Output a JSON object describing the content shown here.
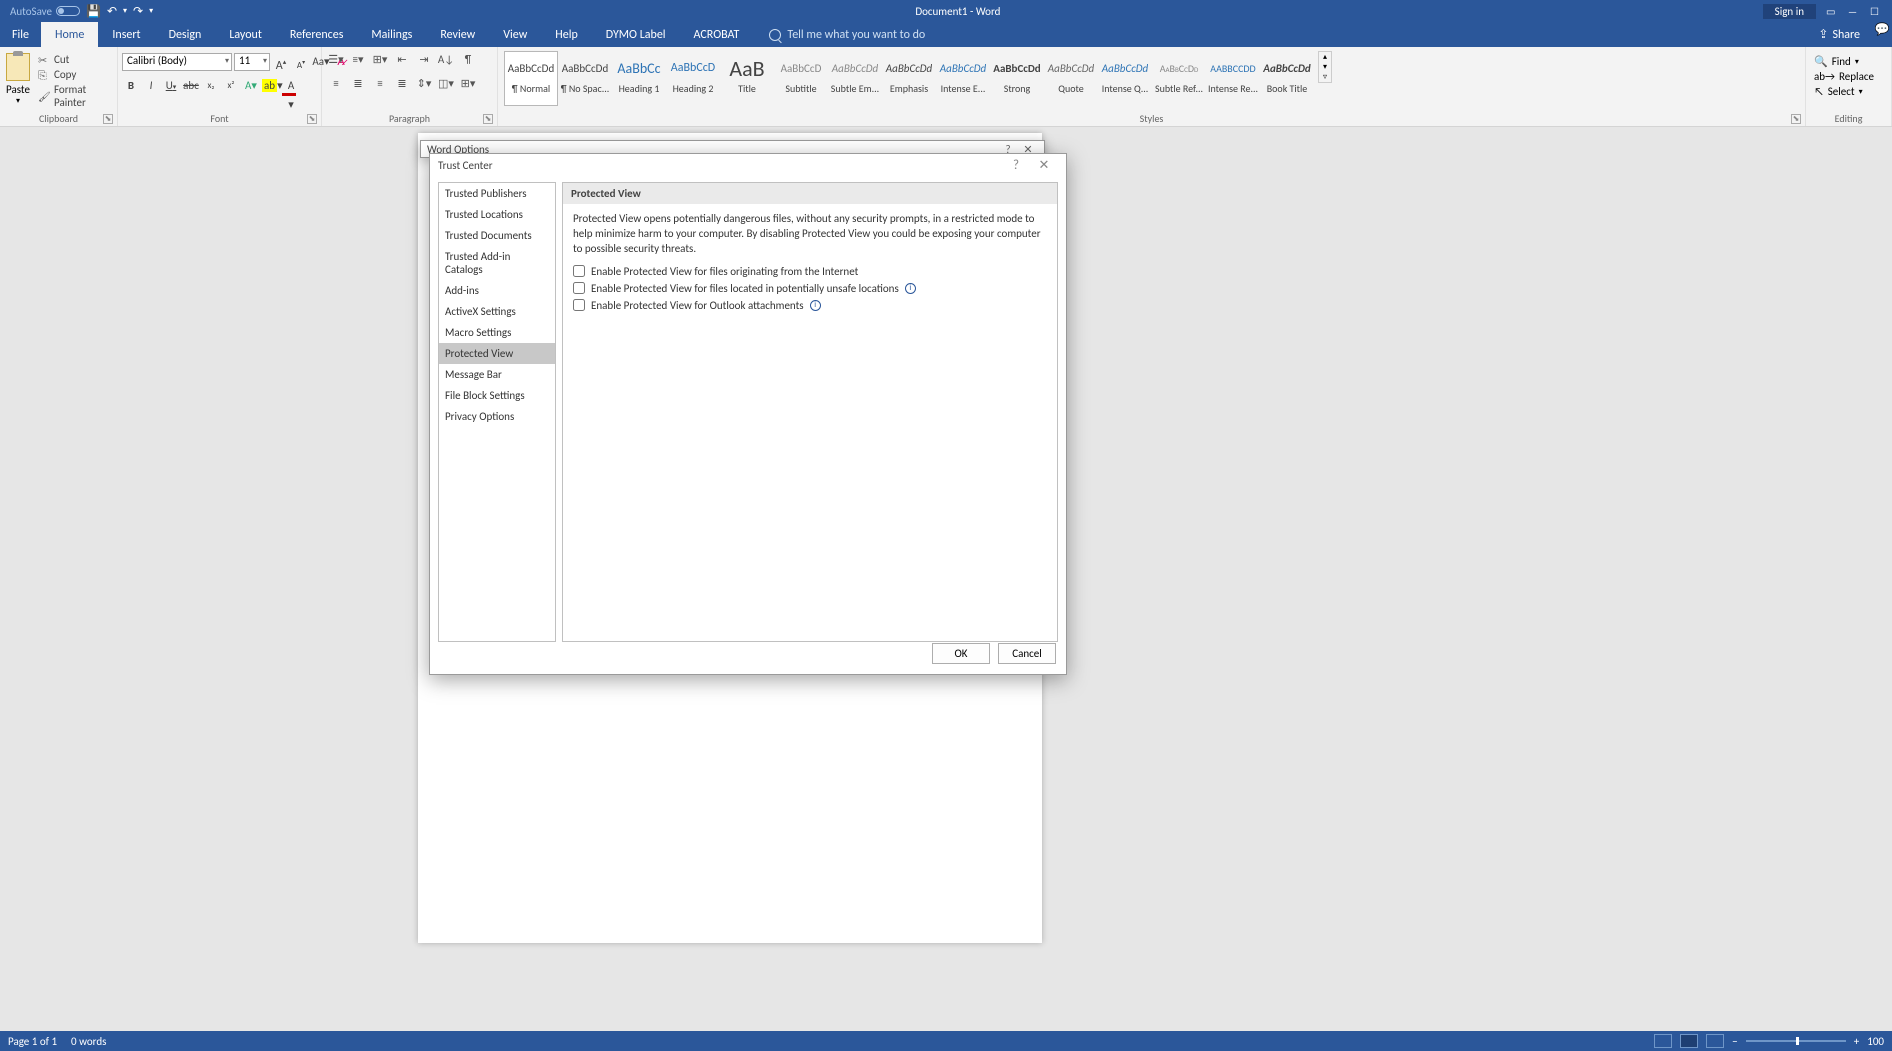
{
  "titlebar": {
    "autosave_label": "AutoSave",
    "doc_title": "Document1 - Word",
    "signin": "Sign in"
  },
  "ribbon_tabs": [
    "File",
    "Home",
    "Insert",
    "Design",
    "Layout",
    "References",
    "Mailings",
    "Review",
    "View",
    "Help",
    "DYMO Label",
    "ACROBAT"
  ],
  "tellme_placeholder": "Tell me what you want to do",
  "share_label": "Share",
  "clipboard": {
    "paste": "Paste",
    "cut": "Cut",
    "copy": "Copy",
    "format_painter": "Format Painter",
    "group_label": "Clipboard"
  },
  "font": {
    "name": "Calibri (Body)",
    "size": "11",
    "group_label": "Font"
  },
  "paragraph": {
    "group_label": "Paragraph"
  },
  "styles": {
    "group_label": "Styles",
    "items": [
      {
        "preview": "AaBbCcDd",
        "name": "¶ Normal",
        "sel": true,
        "style": "font-size:11px;"
      },
      {
        "preview": "AaBbCcDd",
        "name": "¶ No Spac...",
        "style": "font-size:11px;"
      },
      {
        "preview": "AaBbCc",
        "name": "Heading 1",
        "style": "font-size:14px;color:#2e74b5;"
      },
      {
        "preview": "AaBbCcD",
        "name": "Heading 2",
        "style": "font-size:12px;color:#2e74b5;"
      },
      {
        "preview": "AaB",
        "name": "Title",
        "style": "font-size:22px;"
      },
      {
        "preview": "AaBbCcD",
        "name": "Subtitle",
        "style": "font-size:11px;color:#888;"
      },
      {
        "preview": "AaBbCcDd",
        "name": "Subtle Em...",
        "style": "font-size:11px;font-style:italic;color:#888;"
      },
      {
        "preview": "AaBbCcDd",
        "name": "Emphasis",
        "style": "font-size:11px;font-style:italic;"
      },
      {
        "preview": "AaBbCcDd",
        "name": "Intense E...",
        "style": "font-size:11px;font-style:italic;color:#2e74b5;"
      },
      {
        "preview": "AaBbCcDd",
        "name": "Strong",
        "style": "font-size:11px;font-weight:bold;"
      },
      {
        "preview": "AaBbCcDd",
        "name": "Quote",
        "style": "font-size:11px;font-style:italic;color:#666;"
      },
      {
        "preview": "AaBbCcDd",
        "name": "Intense Q...",
        "style": "font-size:11px;font-style:italic;color:#2e74b5;"
      },
      {
        "preview": "AaBbCcDd",
        "name": "Subtle Ref...",
        "style": "font-size:10px;color:#888;font-variant:small-caps;"
      },
      {
        "preview": "AABBCCDD",
        "name": "Intense Re...",
        "style": "font-size:10px;color:#2e74b5;"
      },
      {
        "preview": "AaBbCcDd",
        "name": "Book Title",
        "style": "font-size:11px;font-weight:bold;font-style:italic;"
      }
    ]
  },
  "editing": {
    "find": "Find",
    "replace": "Replace",
    "select": "Select",
    "group_label": "Editing"
  },
  "word_options_title": "Word Options",
  "trust_center": {
    "title": "Trust Center",
    "nav": [
      "Trusted Publishers",
      "Trusted Locations",
      "Trusted Documents",
      "Trusted Add-in Catalogs",
      "Add-ins",
      "ActiveX Settings",
      "Macro Settings",
      "Protected View",
      "Message Bar",
      "File Block Settings",
      "Privacy Options"
    ],
    "active_nav": "Protected View",
    "header": "Protected View",
    "description": "Protected View opens potentially dangerous files, without any security prompts, in a restricted mode to help minimize harm to your computer. By disabling Protected View you could be exposing your computer to possible security threats.",
    "checks": [
      "Enable Protected View for files originating from the Internet",
      "Enable Protected View for files located in potentially unsafe locations",
      "Enable Protected View for Outlook attachments"
    ],
    "ok": "OK",
    "cancel": "Cancel"
  },
  "statusbar": {
    "page": "Page 1 of 1",
    "words": "0 words",
    "zoom": "100"
  }
}
